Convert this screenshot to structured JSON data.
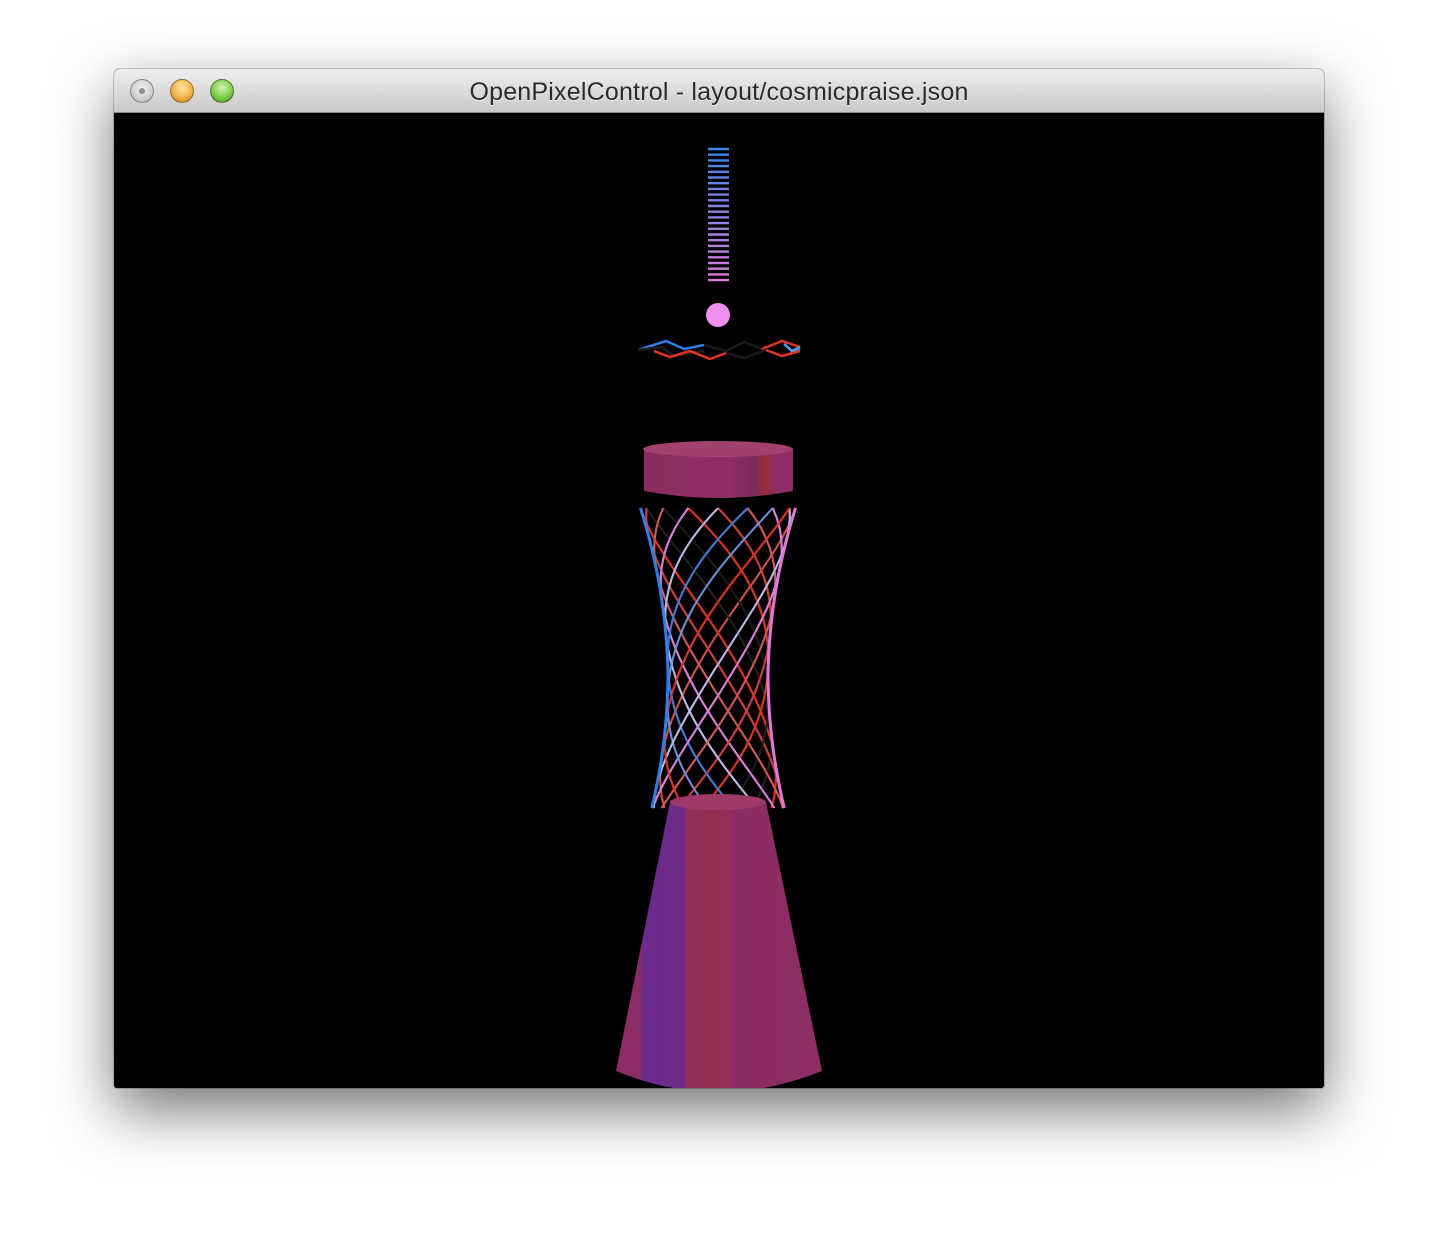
{
  "window": {
    "title": "OpenPixelControl - layout/cosmicpraise.json"
  },
  "controls": {
    "close_icon": "close-dot-icon",
    "minimize_icon": "minimize-dot-icon",
    "zoom_icon": "zoom-dot-icon"
  },
  "viewport": {
    "background": "#000000",
    "model": "cosmicpraise tower",
    "colors": {
      "blue": "#2f7fe8",
      "pink": "#e07ad8",
      "red": "#e23324",
      "magenta_body": "#93305f",
      "purple_body": "#6c2c8c"
    }
  }
}
